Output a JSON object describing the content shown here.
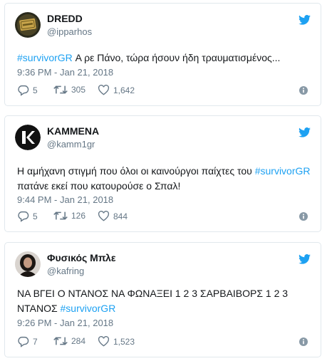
{
  "colors": {
    "accent": "#1da1f2",
    "text": "#14171a",
    "muted": "#657786",
    "border": "#e1e8ed"
  },
  "tweets": [
    {
      "name": "DREDD",
      "handle": "@ipparhos",
      "hashtag": "#survivorGR",
      "text_after": " Α ρε Πάνο, τώρα ήσουν ήδη τραυματισμένος...",
      "timestamp": "9:36 PM - Jan 21, 2018",
      "replies": "5",
      "retweets": "305",
      "likes": "1,642"
    },
    {
      "name": "ΚΑΜΜΕΝΑ",
      "handle": "@kamm1gr",
      "text_before": "Η αμήχανη στιγμή που όλοι οι καινούργοι παίχτες του ",
      "hashtag": "#survivorGR",
      "text_after": " πατάνε εκεί που κατουρούσε ο Σπαλ!",
      "timestamp": "9:44 PM - Jan 21, 2018",
      "replies": "5",
      "retweets": "126",
      "likes": "844"
    },
    {
      "name": "Φυσικός Μπλε",
      "handle": "@kafring",
      "text_before": "ΝΑ ΒΓΕΙ Ο ΝΤΑΝΟΣ ΝΑ ΦΩΝΑΞΕΙ 1 2 3 ΣΑΡΒΑΙΒΟΡΣ 1 2 3 ΝΤΑΝΟΣ ",
      "hashtag": "#survivorGR",
      "timestamp": "9:26 PM - Jan 21, 2018",
      "replies": "7",
      "retweets": "284",
      "likes": "1,523"
    }
  ]
}
